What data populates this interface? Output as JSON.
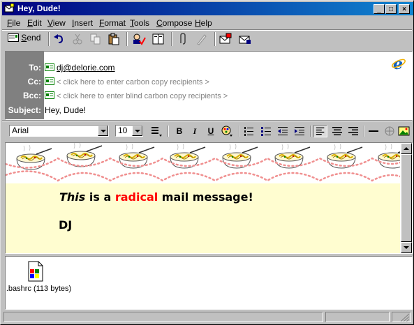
{
  "window": {
    "title": "Hey, Dude!",
    "controls": [
      "_",
      "□",
      "×"
    ]
  },
  "menu": [
    {
      "label": "File",
      "key": "F",
      "rest": "ile"
    },
    {
      "label": "Edit",
      "key": "E",
      "rest": "dit"
    },
    {
      "label": "View",
      "key": "V",
      "rest": "iew"
    },
    {
      "label": "Insert",
      "key": "I",
      "rest": "nsert"
    },
    {
      "label": "Format",
      "key": "F",
      "rest": "ormat"
    },
    {
      "label": "Tools",
      "key": "T",
      "rest": "ools"
    },
    {
      "label": "Compose",
      "key": "C",
      "rest": "ompose"
    },
    {
      "label": "Help",
      "key": "H",
      "rest": "elp"
    }
  ],
  "toolbar": {
    "send_label": "Send",
    "send_key": "S",
    "send_rest": "end",
    "icons": [
      "undo-icon",
      "cut-icon",
      "copy-icon",
      "paste-icon",
      "check-names-icon",
      "address-book-icon",
      "attach-icon",
      "sign-icon",
      "encrypt-icon",
      "secure-icon"
    ]
  },
  "header": {
    "to_label": "To:",
    "cc_label": "Cc:",
    "bcc_label": "Bcc:",
    "subject_label": "Subject:",
    "to_value": "dj@delorie.com",
    "cc_placeholder": "< click here to enter carbon copy recipients >",
    "bcc_placeholder": "< click here to enter blind carbon copy recipients >",
    "subject_value": "Hey, Dude!"
  },
  "format": {
    "font": "Arial",
    "size": "10",
    "bold": "B",
    "italic": "I",
    "underline": "U"
  },
  "message": {
    "word1": "This",
    "word2": " is a ",
    "word3": "radical",
    "word4": " mail message!",
    "signature": "DJ"
  },
  "attachment": {
    "name": ".bashrc (113 bytes)"
  },
  "colors": {
    "titlebar": "#000080",
    "accent_red": "#ff0000",
    "stationery_bg": "#fffdd0"
  }
}
